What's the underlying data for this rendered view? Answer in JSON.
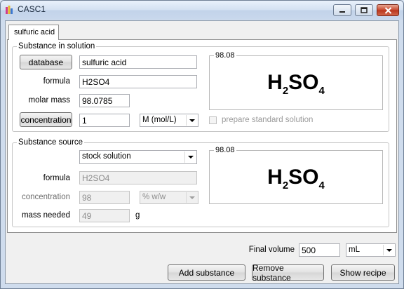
{
  "window": {
    "title": "CASC1",
    "icon": "flask-app-icon",
    "controls": {
      "minimize": "minimize-icon",
      "maximize": "maximize-icon",
      "close": "close-icon"
    }
  },
  "tabs": [
    {
      "label": "sulfuric acid",
      "selected": true
    }
  ],
  "substance_in_solution": {
    "legend": "Substance in solution",
    "database_button": "database",
    "name_value": "sulfuric acid",
    "formula_label": "formula",
    "formula_value": "H2SO4",
    "molar_mass_label": "molar mass",
    "molar_mass_value": "98.0785",
    "concentration_button": "concentration",
    "concentration_value": "1",
    "concentration_unit": "M (mol/L)",
    "preview_legend": "98.08",
    "preview_formula": {
      "h": "H",
      "h_sub": "2",
      "so": "SO",
      "o_sub": "4"
    },
    "prepare_standard_label": "prepare standard solution",
    "prepare_standard_checked": false
  },
  "substance_source": {
    "legend": "Substance source",
    "source_type": "stock solution",
    "formula_label": "formula",
    "formula_value": "H2SO4",
    "concentration_label": "concentration",
    "concentration_value": "98",
    "concentration_unit": "% w/w",
    "mass_needed_label": "mass needed",
    "mass_needed_value": "49",
    "mass_unit": "g",
    "preview_legend": "98.08",
    "preview_formula": {
      "h": "H",
      "h_sub": "2",
      "so": "SO",
      "o_sub": "4"
    }
  },
  "footer": {
    "final_volume_label": "Final volume",
    "final_volume_value": "500",
    "final_volume_unit": "mL",
    "add_button": "Add substance",
    "remove_button": "Remove substance",
    "show_button": "Show recipe"
  }
}
